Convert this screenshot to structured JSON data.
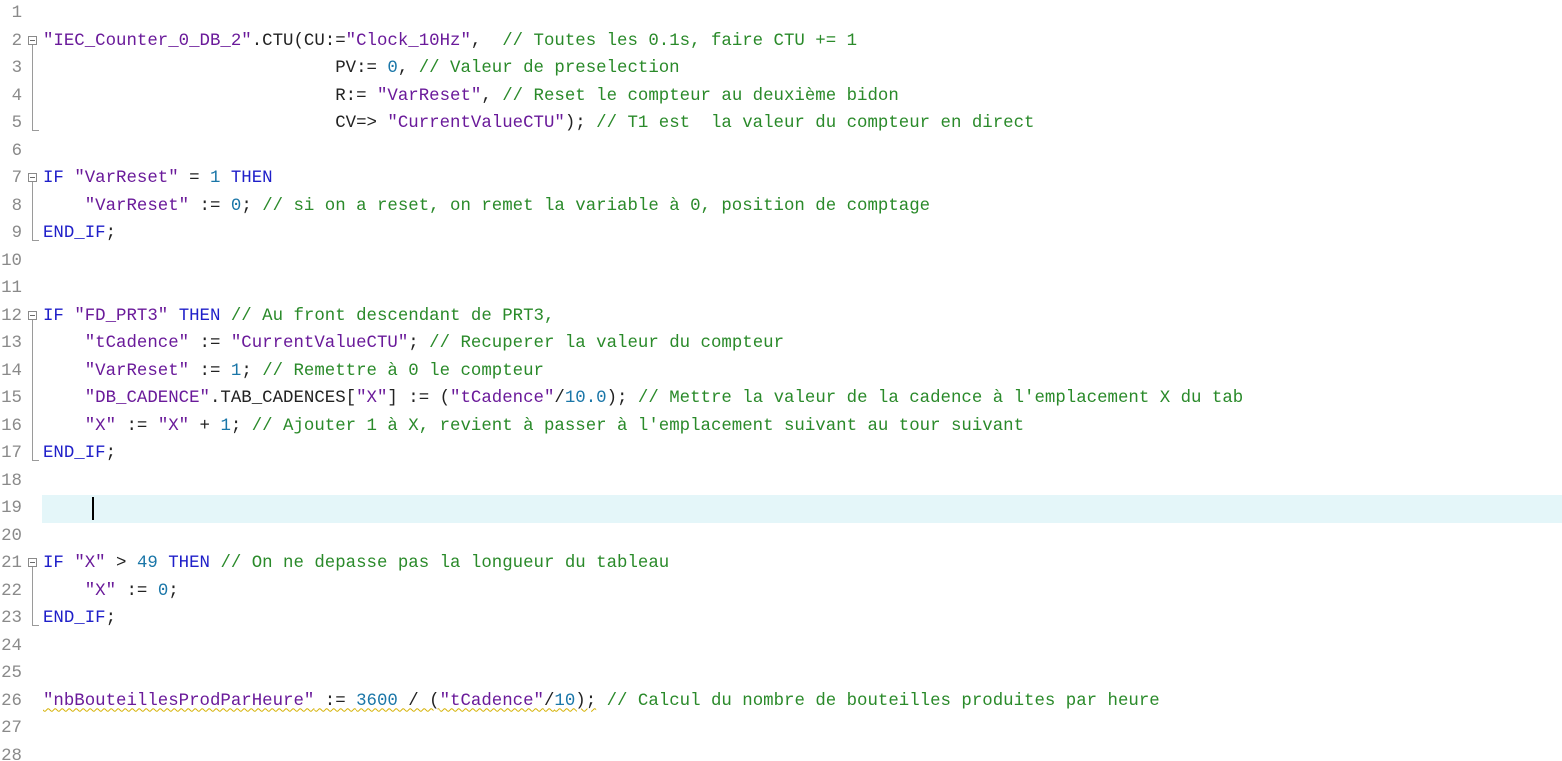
{
  "editor": {
    "current_line": 19,
    "lines": [
      {
        "n": "1",
        "fold": "",
        "tokens": []
      },
      {
        "n": "2",
        "fold": "start",
        "tokens": [
          {
            "t": "str",
            "v": "\"IEC_Counter_0_DB_2\""
          },
          {
            "t": "plain",
            "v": "."
          },
          {
            "t": "plain",
            "v": "CTU"
          },
          {
            "t": "plain",
            "v": "(CU:="
          },
          {
            "t": "str",
            "v": "\"Clock_10Hz\""
          },
          {
            "t": "plain",
            "v": ",  "
          },
          {
            "t": "cmt",
            "v": "// Toutes les 0.1s, faire CTU += 1"
          }
        ]
      },
      {
        "n": "3",
        "fold": "mid",
        "tokens": [
          {
            "t": "plain",
            "v": "                            PV:= "
          },
          {
            "t": "num",
            "v": "0"
          },
          {
            "t": "plain",
            "v": ", "
          },
          {
            "t": "cmt",
            "v": "// Valeur de preselection"
          }
        ]
      },
      {
        "n": "4",
        "fold": "mid",
        "tokens": [
          {
            "t": "plain",
            "v": "                            R:= "
          },
          {
            "t": "str",
            "v": "\"VarReset\""
          },
          {
            "t": "plain",
            "v": ", "
          },
          {
            "t": "cmt",
            "v": "// Reset le compteur au deuxième bidon"
          }
        ]
      },
      {
        "n": "5",
        "fold": "end",
        "tokens": [
          {
            "t": "plain",
            "v": "                            CV=> "
          },
          {
            "t": "str",
            "v": "\"CurrentValueCTU\""
          },
          {
            "t": "plain",
            "v": "); "
          },
          {
            "t": "cmt",
            "v": "// T1 est  la valeur du compteur en direct"
          }
        ]
      },
      {
        "n": "6",
        "fold": "",
        "tokens": []
      },
      {
        "n": "7",
        "fold": "start",
        "tokens": [
          {
            "t": "kw",
            "v": "IF"
          },
          {
            "t": "plain",
            "v": " "
          },
          {
            "t": "str",
            "v": "\"VarReset\""
          },
          {
            "t": "plain",
            "v": " = "
          },
          {
            "t": "num",
            "v": "1"
          },
          {
            "t": "plain",
            "v": " "
          },
          {
            "t": "kw",
            "v": "THEN"
          }
        ]
      },
      {
        "n": "8",
        "fold": "mid",
        "tokens": [
          {
            "t": "plain",
            "v": "    "
          },
          {
            "t": "str",
            "v": "\"VarReset\""
          },
          {
            "t": "plain",
            "v": " := "
          },
          {
            "t": "num",
            "v": "0"
          },
          {
            "t": "plain",
            "v": "; "
          },
          {
            "t": "cmt",
            "v": "// si on a reset, on remet la variable à 0, position de comptage"
          }
        ]
      },
      {
        "n": "9",
        "fold": "end",
        "tokens": [
          {
            "t": "kw",
            "v": "END_IF"
          },
          {
            "t": "plain",
            "v": ";"
          }
        ]
      },
      {
        "n": "10",
        "fold": "",
        "tokens": []
      },
      {
        "n": "11",
        "fold": "",
        "tokens": []
      },
      {
        "n": "12",
        "fold": "start",
        "tokens": [
          {
            "t": "kw",
            "v": "IF"
          },
          {
            "t": "plain",
            "v": " "
          },
          {
            "t": "str",
            "v": "\"FD_PRT3\""
          },
          {
            "t": "plain",
            "v": " "
          },
          {
            "t": "kw",
            "v": "THEN"
          },
          {
            "t": "plain",
            "v": " "
          },
          {
            "t": "cmt",
            "v": "// Au front descendant de PRT3,"
          }
        ]
      },
      {
        "n": "13",
        "fold": "mid",
        "tokens": [
          {
            "t": "plain",
            "v": "    "
          },
          {
            "t": "str",
            "v": "\"tCadence\""
          },
          {
            "t": "plain",
            "v": " := "
          },
          {
            "t": "str",
            "v": "\"CurrentValueCTU\""
          },
          {
            "t": "plain",
            "v": "; "
          },
          {
            "t": "cmt",
            "v": "// Recuperer la valeur du compteur"
          }
        ]
      },
      {
        "n": "14",
        "fold": "mid",
        "tokens": [
          {
            "t": "plain",
            "v": "    "
          },
          {
            "t": "str",
            "v": "\"VarReset\""
          },
          {
            "t": "plain",
            "v": " := "
          },
          {
            "t": "num",
            "v": "1"
          },
          {
            "t": "plain",
            "v": "; "
          },
          {
            "t": "cmt",
            "v": "// Remettre à 0 le compteur"
          }
        ]
      },
      {
        "n": "15",
        "fold": "mid",
        "tokens": [
          {
            "t": "plain",
            "v": "    "
          },
          {
            "t": "str",
            "v": "\"DB_CADENCE\""
          },
          {
            "t": "plain",
            "v": ".TAB_CADENCES["
          },
          {
            "t": "str",
            "v": "\"X\""
          },
          {
            "t": "plain",
            "v": "] := ("
          },
          {
            "t": "str",
            "v": "\"tCadence\""
          },
          {
            "t": "plain",
            "v": "/"
          },
          {
            "t": "num",
            "v": "10.0"
          },
          {
            "t": "plain",
            "v": "); "
          },
          {
            "t": "cmt",
            "v": "// Mettre la valeur de la cadence à l'emplacement X du tab"
          }
        ]
      },
      {
        "n": "16",
        "fold": "mid",
        "tokens": [
          {
            "t": "plain",
            "v": "    "
          },
          {
            "t": "str",
            "v": "\"X\""
          },
          {
            "t": "plain",
            "v": " := "
          },
          {
            "t": "str",
            "v": "\"X\""
          },
          {
            "t": "plain",
            "v": " + "
          },
          {
            "t": "num",
            "v": "1"
          },
          {
            "t": "plain",
            "v": "; "
          },
          {
            "t": "cmt",
            "v": "// Ajouter 1 à X, revient à passer à l'emplacement suivant au tour suivant"
          }
        ]
      },
      {
        "n": "17",
        "fold": "end",
        "tokens": [
          {
            "t": "kw",
            "v": "END_IF"
          },
          {
            "t": "plain",
            "v": ";"
          }
        ]
      },
      {
        "n": "18",
        "fold": "",
        "tokens": []
      },
      {
        "n": "19",
        "fold": "",
        "tokens": []
      },
      {
        "n": "20",
        "fold": "",
        "tokens": []
      },
      {
        "n": "21",
        "fold": "start",
        "tokens": [
          {
            "t": "kw",
            "v": "IF"
          },
          {
            "t": "plain",
            "v": " "
          },
          {
            "t": "str",
            "v": "\"X\""
          },
          {
            "t": "plain",
            "v": " > "
          },
          {
            "t": "num",
            "v": "49"
          },
          {
            "t": "plain",
            "v": " "
          },
          {
            "t": "kw",
            "v": "THEN"
          },
          {
            "t": "plain",
            "v": " "
          },
          {
            "t": "cmt",
            "v": "// On ne depasse pas la longueur du tableau"
          }
        ]
      },
      {
        "n": "22",
        "fold": "mid",
        "tokens": [
          {
            "t": "plain",
            "v": "    "
          },
          {
            "t": "str",
            "v": "\"X\""
          },
          {
            "t": "plain",
            "v": " := "
          },
          {
            "t": "num",
            "v": "0"
          },
          {
            "t": "plain",
            "v": ";"
          }
        ]
      },
      {
        "n": "23",
        "fold": "end",
        "tokens": [
          {
            "t": "kw",
            "v": "END_IF"
          },
          {
            "t": "plain",
            "v": ";"
          }
        ]
      },
      {
        "n": "24",
        "fold": "",
        "tokens": []
      },
      {
        "n": "25",
        "fold": "",
        "tokens": []
      },
      {
        "n": "26",
        "fold": "",
        "tokens": [
          {
            "t": "str",
            "v": "\"nbBouteillesProdParHeure\"",
            "squiggle": true
          },
          {
            "t": "plain",
            "v": " := ",
            "squiggle": true
          },
          {
            "t": "num",
            "v": "3600",
            "squiggle": true
          },
          {
            "t": "plain",
            "v": " / (",
            "squiggle": true
          },
          {
            "t": "str",
            "v": "\"tCadence\"",
            "squiggle": true
          },
          {
            "t": "plain",
            "v": "/",
            "squiggle": true
          },
          {
            "t": "num",
            "v": "10",
            "squiggle": true
          },
          {
            "t": "plain",
            "v": ");",
            "squiggle": true
          },
          {
            "t": "plain",
            "v": " "
          },
          {
            "t": "cmt",
            "v": "// Calcul du nombre de bouteilles produites par heure"
          }
        ]
      },
      {
        "n": "27",
        "fold": "",
        "tokens": []
      },
      {
        "n": "28",
        "fold": "",
        "tokens": []
      }
    ]
  }
}
